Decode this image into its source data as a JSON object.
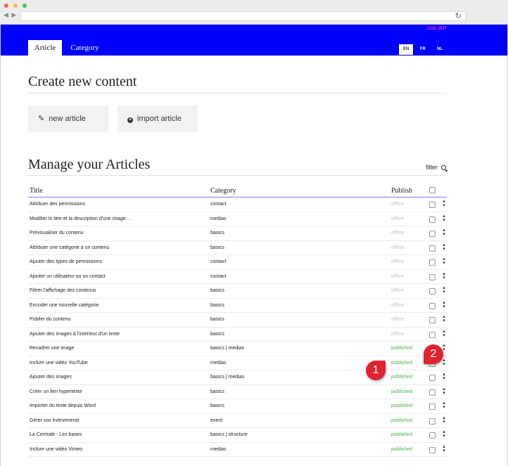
{
  "browser": {
    "nav_arrows": "◀ ▶",
    "reload_icon": "↻"
  },
  "topbar": {
    "user_link": "LOG OUT",
    "tabs": [
      {
        "label": "Article",
        "active": true
      },
      {
        "label": "Category",
        "active": false
      }
    ],
    "languages": [
      "EN",
      "FR",
      "NL"
    ],
    "active_language": "EN"
  },
  "create": {
    "title": "Create new content",
    "new_article": "new article",
    "import_article": "import article"
  },
  "manage": {
    "title": "Manage your Articles",
    "filter_label": "filter",
    "columns": {
      "title": "Title",
      "category": "Category",
      "publish": "Publish"
    },
    "rows": [
      {
        "title": "Attribuer des permissions",
        "category": "contact",
        "status": "offline"
      },
      {
        "title": "Modifier le titre et la description d'une image ...",
        "category": "medias",
        "status": "offline"
      },
      {
        "title": "Prévisualiser du contenu",
        "category": "basics",
        "status": "offline"
      },
      {
        "title": "Attribuer une catégorie à un contenu",
        "category": "basics",
        "status": "offline"
      },
      {
        "title": "Ajouter des types de permissions",
        "category": "contact",
        "status": "offline"
      },
      {
        "title": "Ajouter un utilisateur ou un contact",
        "category": "contact",
        "status": "offline"
      },
      {
        "title": "Filtrer l'affichage des contenus",
        "category": "basics",
        "status": "offline"
      },
      {
        "title": "Encoder une nouvelle catégorie",
        "category": "basics",
        "status": "offline"
      },
      {
        "title": "Publier du contenu",
        "category": "basics",
        "status": "offline"
      },
      {
        "title": "Ajouter des images à l'intérieur d'un texte",
        "category": "basics",
        "status": "offline"
      },
      {
        "title": "Recadrer une image",
        "category": "basics | medias",
        "status": "published"
      },
      {
        "title": "Inclure une vidéo YouTube",
        "category": "medias",
        "status": "published"
      },
      {
        "title": "Ajouter des images",
        "category": "basics | medias",
        "status": "published"
      },
      {
        "title": "Créer un lien hypertexte",
        "category": "basics",
        "status": "published"
      },
      {
        "title": "Importer du texte depuis Word",
        "category": "basics",
        "status": "published"
      },
      {
        "title": "Gérer vos évènements",
        "category": "event",
        "status": "published"
      },
      {
        "title": "La Centrale - Les bases",
        "category": "basics | structure",
        "status": "published"
      },
      {
        "title": "Inclure une vidéo Vimeo",
        "category": "medias",
        "status": "published"
      }
    ]
  },
  "callouts": [
    "1",
    "2"
  ],
  "colors": {
    "topbar": "#0000ff",
    "published": "#4caf50",
    "offline": "#c4c4c4",
    "callout": "#e0242f"
  }
}
